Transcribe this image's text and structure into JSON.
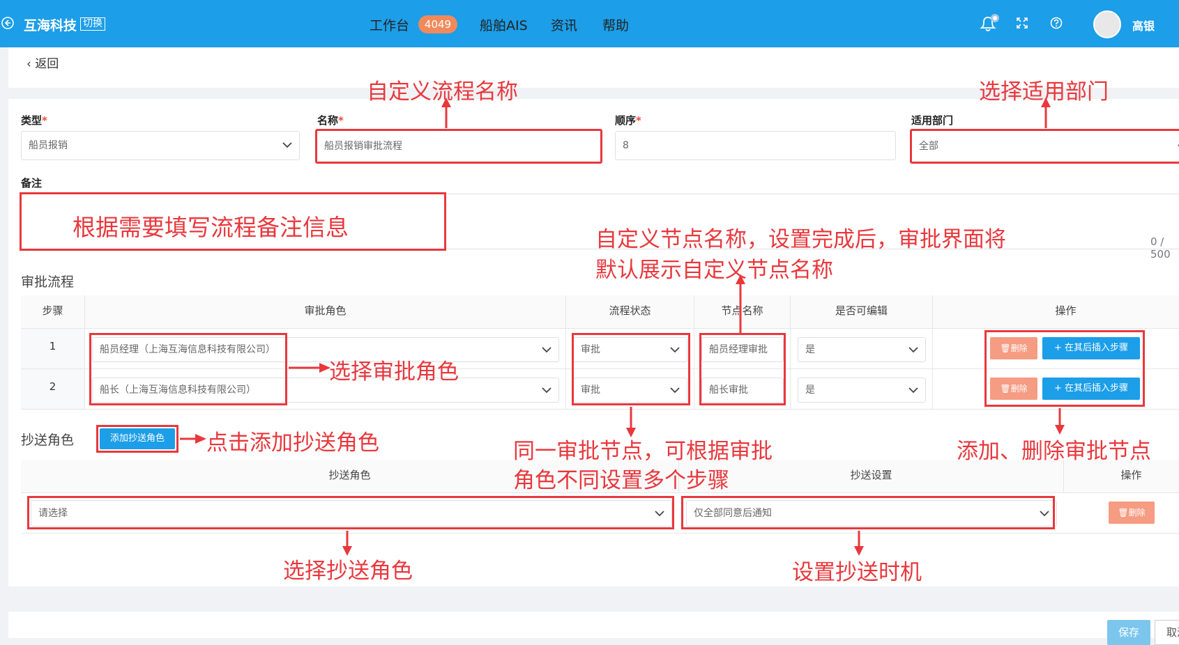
{
  "header": {
    "brand": "互海科技",
    "switch_label": "切换",
    "nav": [
      "工作台",
      "船舶AIS",
      "资讯",
      "帮助"
    ],
    "badge": "4049",
    "username": "高银"
  },
  "back_label": "返回",
  "form": {
    "type_label": "类型",
    "type_value": "船员报销",
    "name_label": "名称",
    "name_value": "船员报销审批流程",
    "order_label": "顺序",
    "order_value": "8",
    "dept_label": "适用部门",
    "dept_value": "全部",
    "remark_label": "备注",
    "remark_counter": "0 / 500",
    "required_mark": "*"
  },
  "approval": {
    "section_title": "审批流程",
    "headers": [
      "步骤",
      "审批角色",
      "流程状态",
      "节点名称",
      "是否可编辑",
      "操作"
    ],
    "rows": [
      {
        "step": "1",
        "role": "船员经理（上海互海信息科技有限公司）",
        "status": "审批",
        "node": "船员经理审批",
        "editable": "是"
      },
      {
        "step": "2",
        "role": "船长（上海互海信息科技有限公司）",
        "status": "审批",
        "node": "船长审批",
        "editable": "是"
      }
    ],
    "delete_label": "删除",
    "insert_label": "+ 在其后插入步骤"
  },
  "cc": {
    "section_title": "抄送角色",
    "add_button": "添加抄送角色",
    "headers": [
      "抄送角色",
      "抄送设置",
      "操作"
    ],
    "role_placeholder": "请选择",
    "setting_value": "仅全部同意后通知",
    "delete_label": "删除"
  },
  "footer": {
    "save": "保存",
    "cancel": "取消"
  },
  "annotations": {
    "name": "自定义流程名称",
    "dept": "选择适用部门",
    "remark": "根据需要填写流程备注信息",
    "node_line1": "自定义节点名称，设置完成后，审批界面将",
    "node_line2": "默认展示自定义节点名称",
    "role": "选择审批角色",
    "add_cc": "点击添加抄送角色",
    "multi_line1": "同一审批节点，可根据审批",
    "multi_line2": "角色不同设置多个步骤",
    "add_del": "添加、删除审批节点",
    "cc_role": "选择抄送角色",
    "cc_time": "设置抄送时机"
  },
  "colors": {
    "header_bg": "#1c9ee8",
    "annotation_red": "#e8383d",
    "delete_btn": "#f59c83",
    "badge": "#f08a5a"
  }
}
